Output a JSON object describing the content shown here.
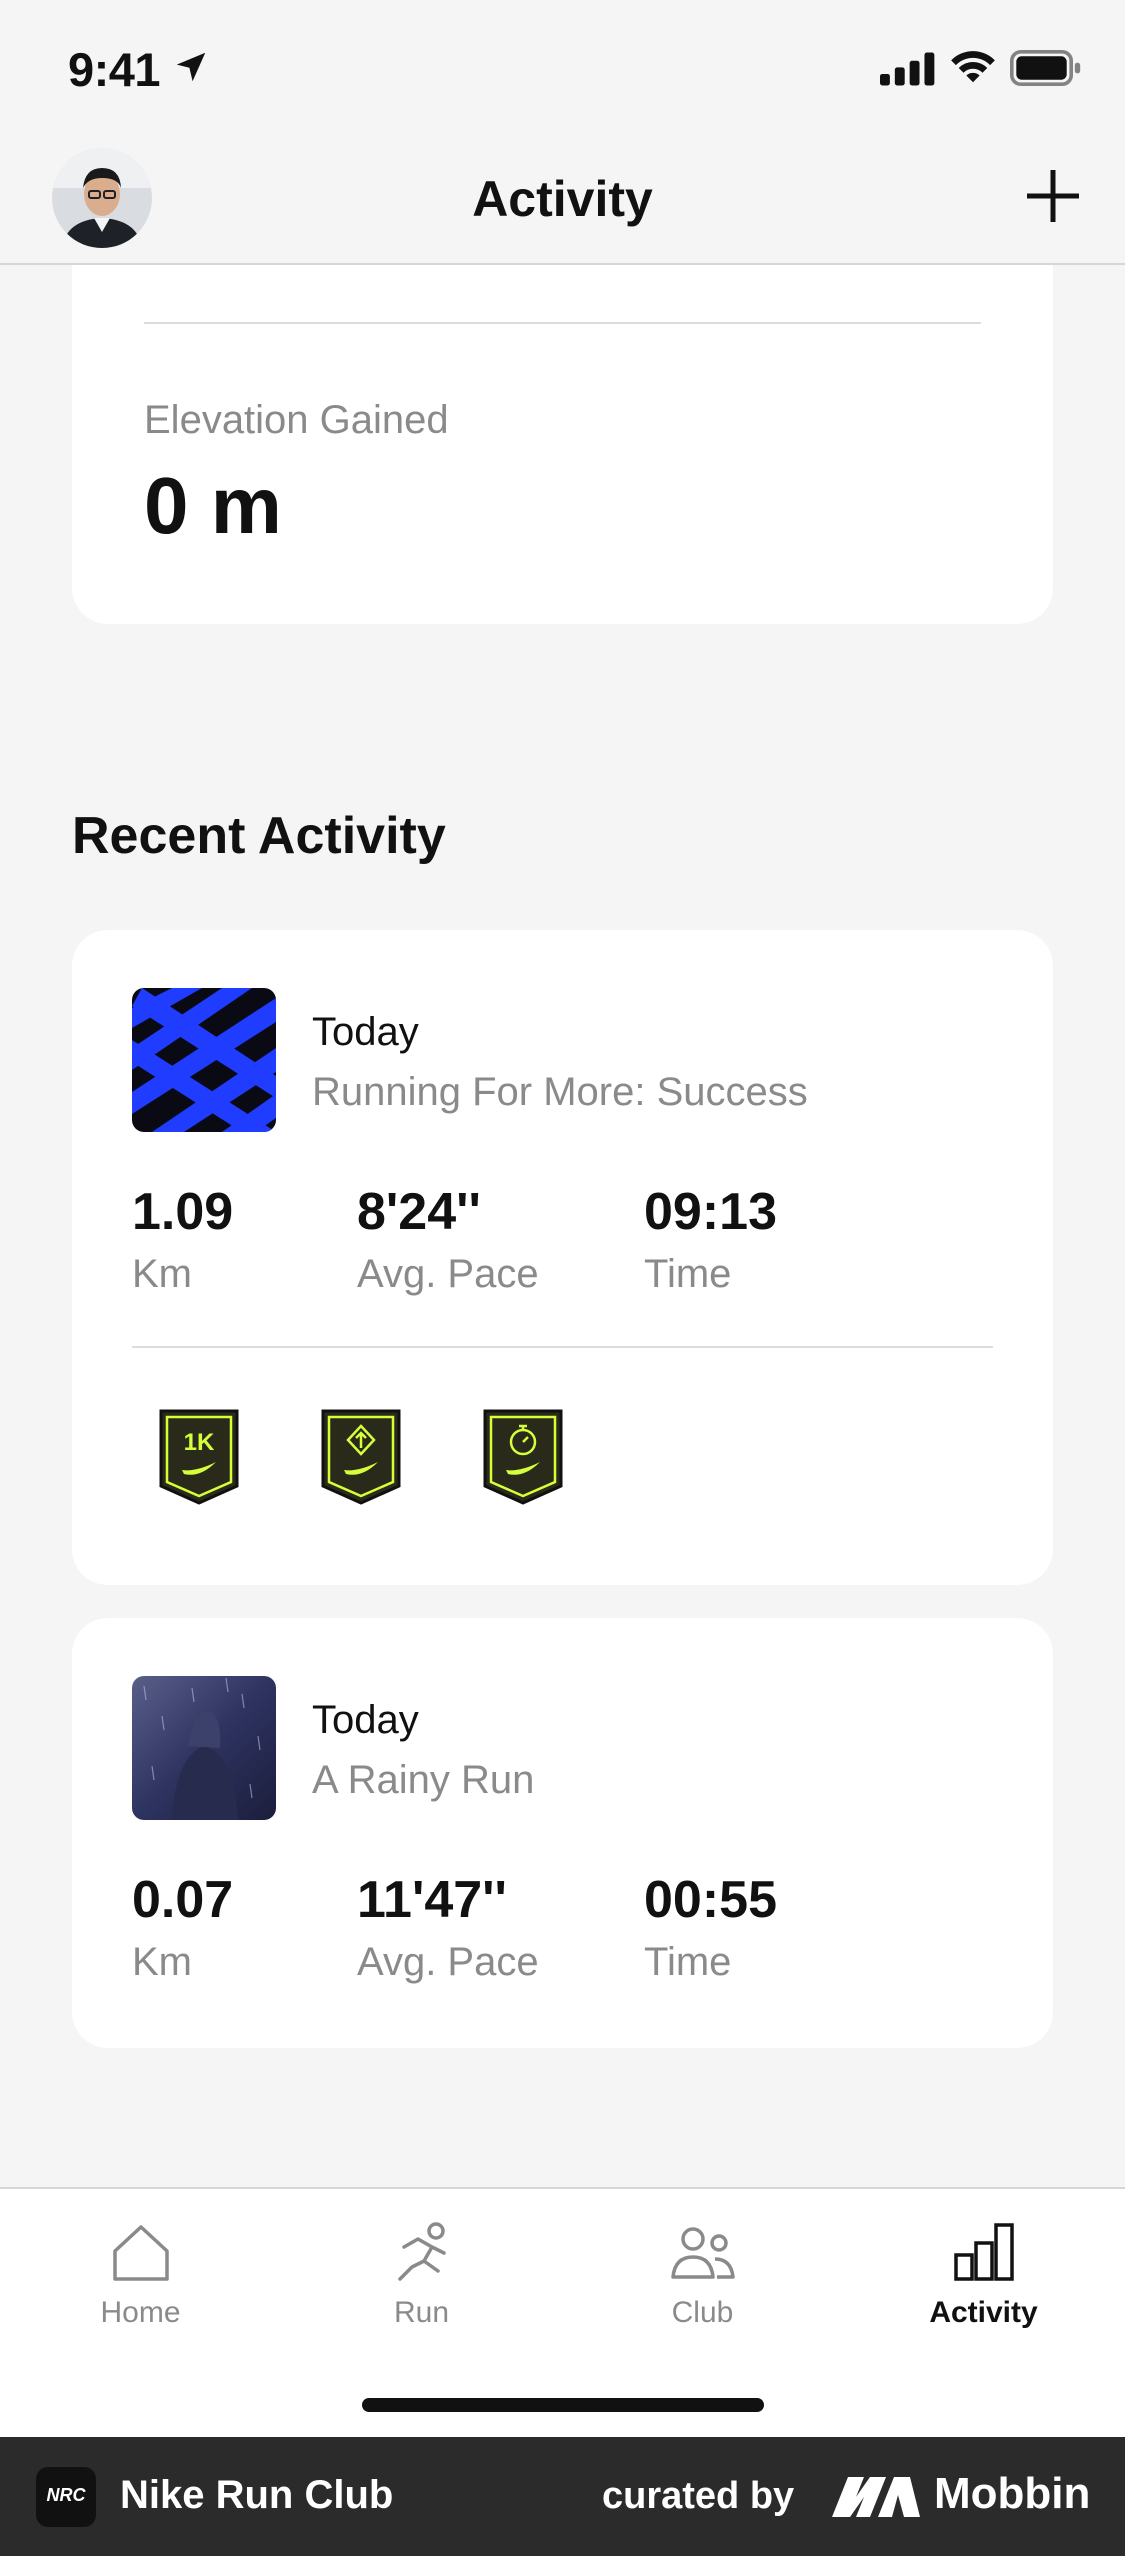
{
  "status_bar": {
    "time": "9:41"
  },
  "header": {
    "title": "Activity"
  },
  "summary": {
    "elevation_label": "Elevation Gained",
    "elevation_value": "0 m"
  },
  "recent": {
    "title": "Recent Activity",
    "activities": [
      {
        "date": "Today",
        "name": "Running For More: Success",
        "distance": "1.09",
        "distance_label": "Km",
        "pace": "8'24''",
        "pace_label": "Avg. Pace",
        "time": "09:13",
        "time_label": "Time",
        "badges": [
          {
            "text": "1K",
            "icon": "badge-1k-icon"
          },
          {
            "icon": "badge-direction-icon"
          },
          {
            "icon": "badge-stopwatch-icon"
          }
        ]
      },
      {
        "date": "Today",
        "name": "A Rainy Run",
        "distance": "0.07",
        "distance_label": "Km",
        "pace": "11'47''",
        "pace_label": "Avg. Pace",
        "time": "00:55",
        "time_label": "Time"
      }
    ]
  },
  "tab_bar": {
    "items": [
      {
        "label": "Home",
        "icon": "home-icon"
      },
      {
        "label": "Run",
        "icon": "run-icon"
      },
      {
        "label": "Club",
        "icon": "club-icon"
      },
      {
        "label": "Activity",
        "icon": "activity-icon",
        "active": true
      }
    ]
  },
  "footer": {
    "logo_text": "NRC",
    "app_name": "Nike Run Club",
    "curated_by": "curated by",
    "brand": "Mobbin"
  },
  "colors": {
    "badge_bg": "#2a2a1a",
    "badge_accent": "#d4ff3a",
    "thumb_blue": "#1f3cff"
  }
}
